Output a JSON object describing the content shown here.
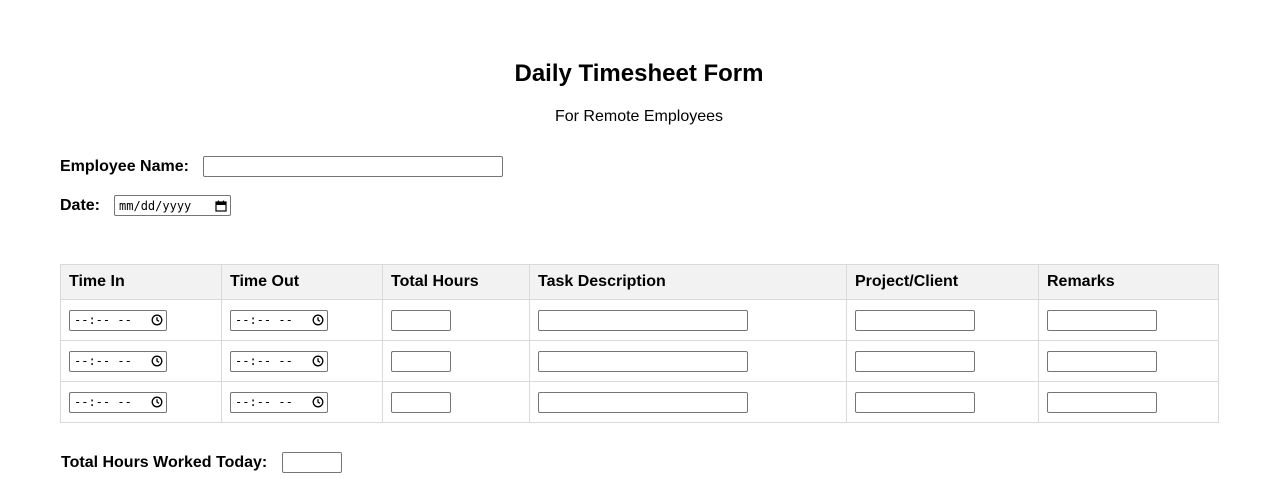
{
  "header": {
    "title": "Daily Timesheet Form",
    "subtitle": "For Remote Employees"
  },
  "employee": {
    "name_label": "Employee Name:",
    "name_value": ""
  },
  "date": {
    "label": "Date:",
    "placeholder": "mm/dd/yyyy"
  },
  "table": {
    "columns": [
      "Time In",
      "Time Out",
      "Total Hours",
      "Task Description",
      "Project/Client",
      "Remarks"
    ],
    "time_placeholder": "--:-- --",
    "rows": [
      {
        "time_in": "",
        "time_out": "",
        "total_hours": "",
        "task": "",
        "project": "",
        "remarks": ""
      },
      {
        "time_in": "",
        "time_out": "",
        "total_hours": "",
        "task": "",
        "project": "",
        "remarks": ""
      },
      {
        "time_in": "",
        "time_out": "",
        "total_hours": "",
        "task": "",
        "project": "",
        "remarks": ""
      }
    ]
  },
  "total": {
    "label": "Total Hours Worked Today:",
    "value": ""
  },
  "icons": {
    "time_picker": "clock-icon",
    "date_picker": "calendar-icon"
  }
}
